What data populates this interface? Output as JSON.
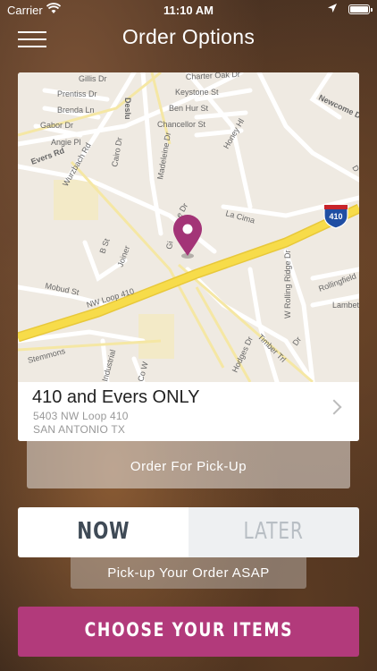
{
  "status_bar": {
    "carrier": "Carrier",
    "time": "11:10 AM"
  },
  "nav": {
    "title": "Order Options"
  },
  "map": {
    "street_labels": [
      "Gillis Dr",
      "Prentiss Dr",
      "Brenda Ln",
      "Gabor Dr",
      "Angie Pl",
      "Evers Rd",
      "Wurzbach Rd",
      "Charter Oak Dr",
      "Keystone St",
      "Ben Hur St",
      "Chancellor St",
      "Newcome Dr",
      "Honey Hl",
      "Cairo Dr",
      "Madeleine Dr",
      "La Cima",
      "B St",
      "Joiner",
      "Mobud St",
      "NW Loop 410",
      "Stemmons",
      "Industrial",
      "Co W",
      "Hodges Dr",
      "Timber Trl",
      "W Rolling Ridge Dr",
      "Rollingfield",
      "Lambet",
      "Deslu",
      "Gi",
      "e Dr",
      "Dr",
      "D"
    ],
    "highway_shield": "410"
  },
  "store": {
    "name": "410 and Evers ONLY",
    "address_line1": "5403 NW Loop 410",
    "address_line2": "SAN ANTONIO TX"
  },
  "order_type": {
    "label": "Order For Pick-Up"
  },
  "timing": {
    "now_label": "NOW",
    "later_label": "LATER",
    "selected": "NOW",
    "description": "Pick-up Your Order ASAP"
  },
  "cta": {
    "label": "CHOOSE YOUR ITEMS"
  },
  "colors": {
    "accent": "#b23a7b",
    "pin": "#a33477",
    "highway": "#f7dc4a"
  },
  "icons": [
    "hamburger-icon",
    "wifi-icon",
    "location-arrow-icon",
    "battery-icon",
    "map-pin-icon",
    "chevron-right-icon"
  ]
}
